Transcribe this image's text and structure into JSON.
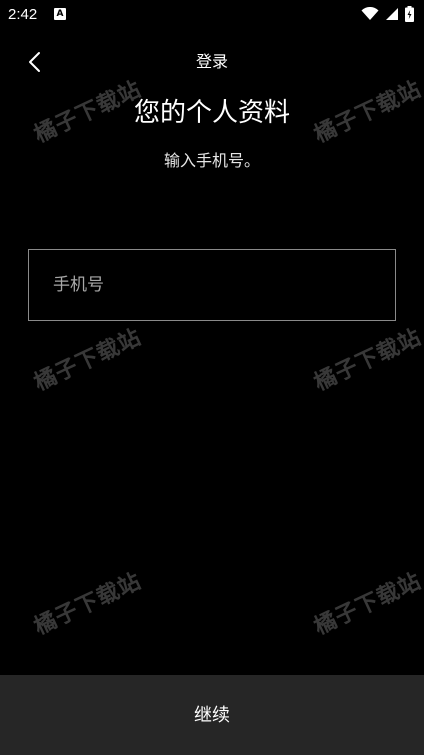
{
  "status_bar": {
    "time": "2:42",
    "notification_icon": "A"
  },
  "header": {
    "back_icon": "chevron-left-icon",
    "title": "登录"
  },
  "main": {
    "title": "您的个人资料",
    "subtitle": "输入手机号。",
    "phone_field": {
      "value": "",
      "placeholder": "手机号"
    }
  },
  "watermark": {
    "text": "橘子下载站"
  },
  "footer": {
    "continue_label": "继续"
  },
  "colors": {
    "background": "#000000",
    "text": "#ffffff",
    "input_border": "#8a8a8a",
    "button_background": "#262626"
  }
}
